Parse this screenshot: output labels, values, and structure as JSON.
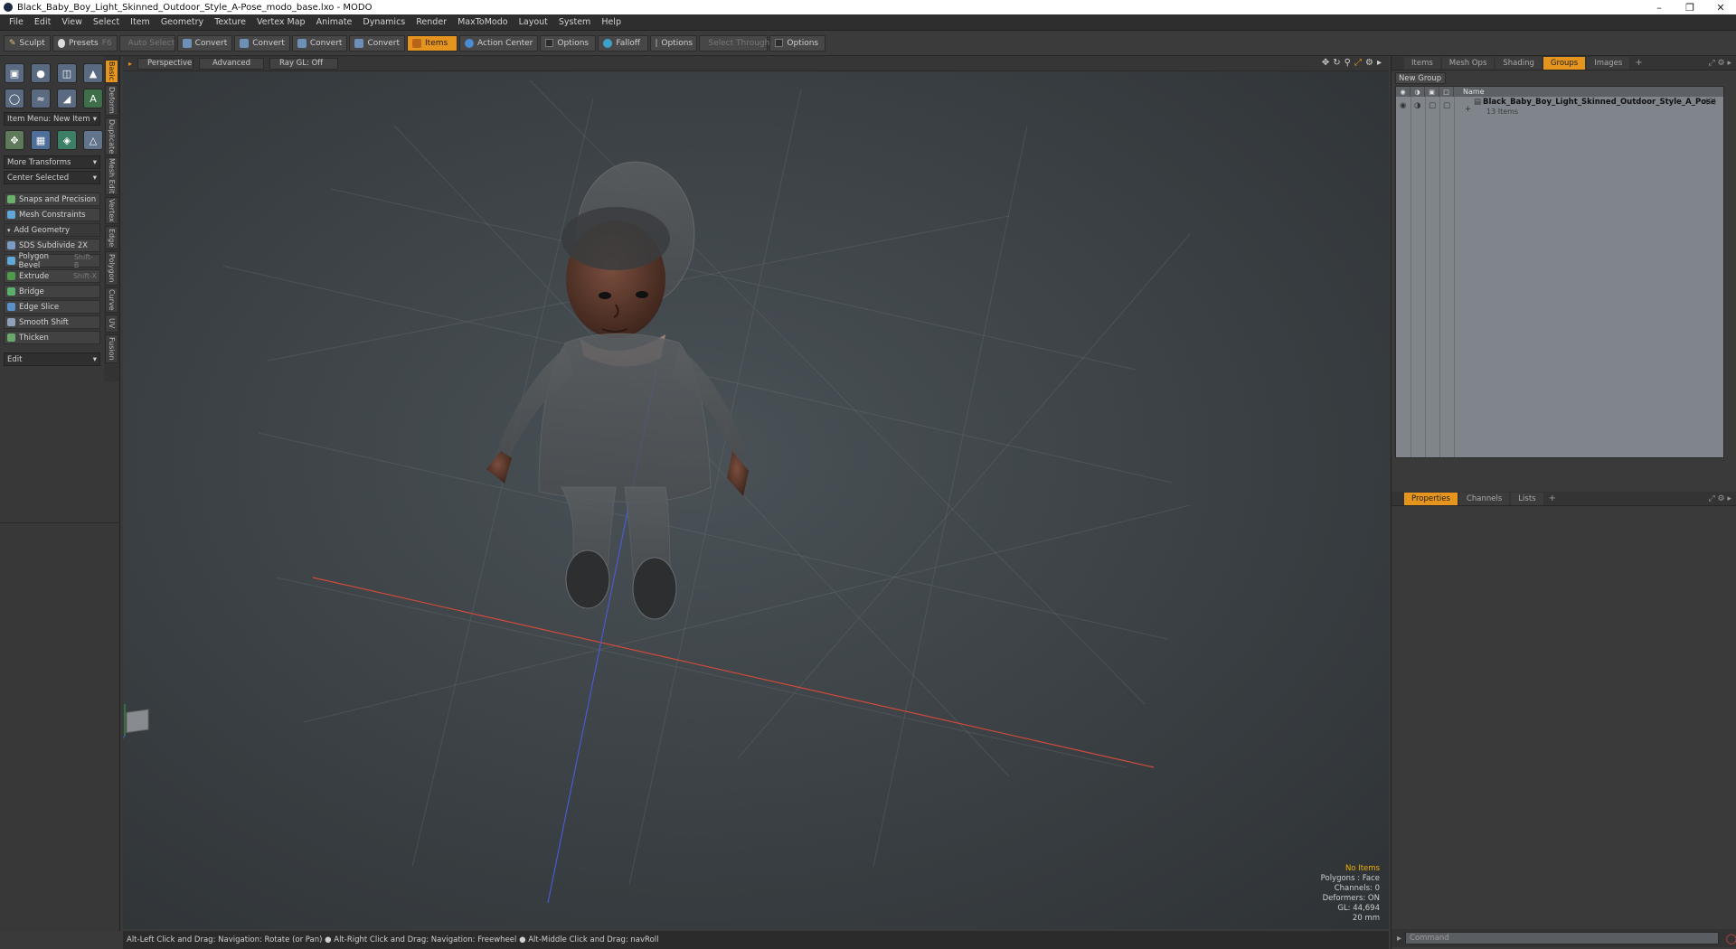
{
  "window": {
    "title": "Black_Baby_Boy_Light_Skinned_Outdoor_Style_A-Pose_modo_base.lxo - MODO"
  },
  "menu": [
    "File",
    "Edit",
    "View",
    "Select",
    "Item",
    "Geometry",
    "Texture",
    "Vertex Map",
    "Animate",
    "Dynamics",
    "Render",
    "MaxToModo",
    "Layout",
    "System",
    "Help"
  ],
  "toolbar": {
    "sculpt": "Sculpt",
    "presets": "Presets",
    "presets_key": "F6",
    "auto_select": "Auto Select",
    "convert_1": "Convert",
    "convert_2": "Convert",
    "convert_3": "Convert",
    "convert_4": "Convert",
    "items": "Items",
    "action_center": "Action Center",
    "options_1": "Options",
    "falloff": "Falloff",
    "options_2": "Options",
    "select_through": "Select Through",
    "options_3": "Options"
  },
  "left_panel": {
    "item_menu": "Item Menu: New Item",
    "more_transforms": "More Transforms",
    "center_selected": "Center Selected",
    "snaps": "Snaps and Precision",
    "mesh_constraints": "Mesh Constraints",
    "add_geometry": "Add Geometry",
    "tools": [
      {
        "label": "SDS Subdivide 2X",
        "shortcut": "",
        "color": "#7a9cc4"
      },
      {
        "label": "Polygon Bevel",
        "shortcut": "Shift-B",
        "color": "#5fa8d8"
      },
      {
        "label": "Extrude",
        "shortcut": "Shift-X",
        "color": "#4f9a4a"
      },
      {
        "label": "Bridge",
        "shortcut": "",
        "color": "#5bb06a"
      },
      {
        "label": "Edge Slice",
        "shortcut": "",
        "color": "#5a8fc8"
      },
      {
        "label": "Smooth Shift",
        "shortcut": "",
        "color": "#8fa0b8"
      },
      {
        "label": "Thicken",
        "shortcut": "",
        "color": "#6aa86a"
      }
    ],
    "edit": "Edit",
    "vertical_tabs": [
      "Basic",
      "Deform",
      "Duplicate",
      "Mesh Edit",
      "Vertex",
      "Edge",
      "Polygon",
      "Curve",
      "UV",
      "Fusion"
    ]
  },
  "viewport": {
    "view": "Perspective",
    "mode": "Advanced",
    "raygl": "Ray GL: Off",
    "info": {
      "selection": "No Items",
      "polygons": "Polygons : Face",
      "channels": "Channels: 0",
      "deformers": "Deformers: ON",
      "gl": "GL: 44,694",
      "unit": "20 mm"
    }
  },
  "status": "Alt-Left Click and Drag: Navigation: Rotate (or Pan) ● Alt-Right Click and Drag: Navigation: Freewheel ● Alt-Middle Click and Drag: navRoll",
  "right_panel": {
    "tabs": [
      "Items",
      "Mesh Ops",
      "Shading",
      "Groups",
      "Images"
    ],
    "new_group": "New Group",
    "list_header": "Name",
    "group_name": "Black_Baby_Boy_Light_Skinned_Outdoor_Style_A_Pose",
    "group_count": "(2)",
    "group_items": "13 Items",
    "props_tabs": [
      "Properties",
      "Channels",
      "Lists"
    ],
    "command_placeholder": "Command"
  },
  "colors": {
    "accent": "#e5941e"
  }
}
